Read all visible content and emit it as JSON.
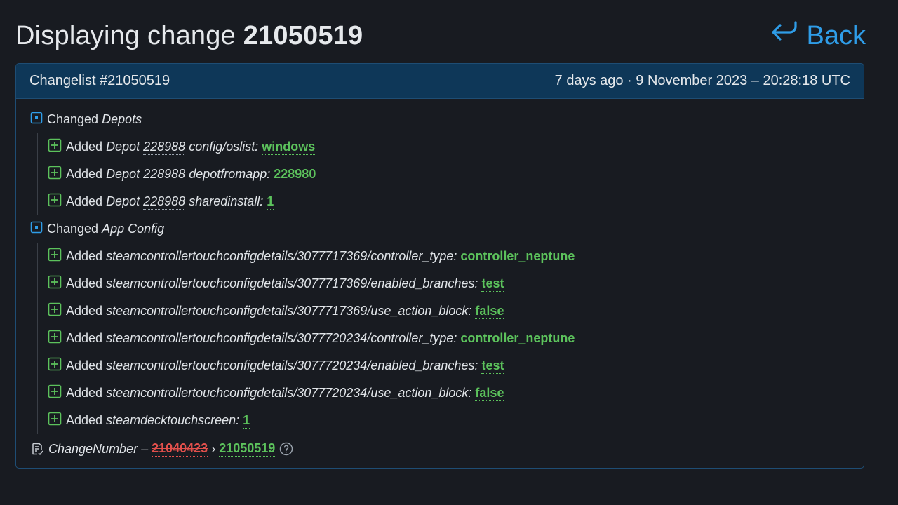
{
  "header": {
    "title_prefix": "Displaying change",
    "title_number": "21050519",
    "back_label": "Back"
  },
  "panel": {
    "changelist": "Changelist #21050519",
    "when": "7 days ago · 9 November 2023 – 20:28:18 UTC"
  },
  "groups": [
    {
      "action": "Changed",
      "name": "Depots",
      "items": [
        {
          "action": "Added",
          "kind": "Depot",
          "id": "228988",
          "key": "config/oslist:",
          "value": "windows"
        },
        {
          "action": "Added",
          "kind": "Depot",
          "id": "228988",
          "key": "depotfromapp:",
          "value": "228980"
        },
        {
          "action": "Added",
          "kind": "Depot",
          "id": "228988",
          "key": "sharedinstall:",
          "value": "1"
        }
      ]
    },
    {
      "action": "Changed",
      "name": "App Config",
      "items": [
        {
          "action": "Added",
          "key": "steamcontrollertouchconfigdetails/3077717369/controller_type:",
          "value": "controller_neptune"
        },
        {
          "action": "Added",
          "key": "steamcontrollertouchconfigdetails/3077717369/enabled_branches:",
          "value": "test"
        },
        {
          "action": "Added",
          "key": "steamcontrollertouchconfigdetails/3077717369/use_action_block:",
          "value": "false"
        },
        {
          "action": "Added",
          "key": "steamcontrollertouchconfigdetails/3077720234/controller_type:",
          "value": "controller_neptune"
        },
        {
          "action": "Added",
          "key": "steamcontrollertouchconfigdetails/3077720234/enabled_branches:",
          "value": "test"
        },
        {
          "action": "Added",
          "key": "steamcontrollertouchconfigdetails/3077720234/use_action_block:",
          "value": "false"
        },
        {
          "action": "Added",
          "key": "steamdecktouchscreen:",
          "value": "1"
        }
      ]
    }
  ],
  "change_number": {
    "label": "ChangeNumber –",
    "old": "21040423",
    "arrow": "›",
    "new": "21050519"
  },
  "icons": {
    "back": "back-arrow-icon",
    "group": "collapse-box-icon",
    "added": "plus-box-icon",
    "changenumber": "document-edit-icon",
    "help": "question-circle-icon"
  },
  "colors": {
    "background": "#181b21",
    "panel_header": "#0e3758",
    "link": "#2f9de8",
    "added": "#5cc25c",
    "removed": "#e2504c"
  }
}
